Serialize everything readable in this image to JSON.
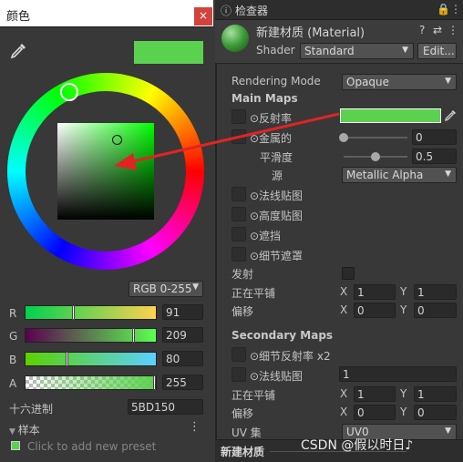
{
  "color_picker": {
    "title": "颜色",
    "close": "×",
    "current_color": "#5bd150",
    "mode": "RGB 0-255",
    "channels": [
      {
        "label": "R",
        "value": "91"
      },
      {
        "label": "G",
        "value": "209"
      },
      {
        "label": "B",
        "value": "80"
      },
      {
        "label": "A",
        "value": "255"
      }
    ],
    "channel_fractions": {
      "R": 0.357,
      "G": 0.82,
      "B": 0.314,
      "A": 1.0
    },
    "hex_label": "十六进制",
    "hex_value": "5BD150",
    "presets_label": "样本",
    "presets_hint": "Click to add new preset",
    "more_icon": "⋮"
  },
  "inspector": {
    "tab_title": "检查器",
    "material_name": "新建材质 (Material)",
    "shader_label": "Shader",
    "shader_value": "Standard",
    "edit_label": "Edit...",
    "rendering_mode_label": "Rendering Mode",
    "rendering_mode_value": "Opaque",
    "main_maps_label": "Main Maps",
    "albedo_label": "⊙反射率",
    "albedo_color": "#5bd150",
    "metallic_label": "⊙金属的",
    "metallic_value": "0",
    "smoothness_label": "平滑度",
    "smoothness_value": "0.5",
    "smoothness_fraction": 0.5,
    "source_label": "源",
    "source_value": "Metallic Alpha",
    "normal_label": "⊙法线贴图",
    "height_label": "⊙高度贴图",
    "occlusion_label": "⊙遮挡",
    "detail_mask_label": "⊙细节遮罩",
    "emission_label": "发射",
    "tiling_label": "正在平铺",
    "offset_label": "偏移",
    "x_label": "X",
    "y_label": "Y",
    "main_tiling_x": "1",
    "main_tiling_y": "1",
    "main_offset_x": "0",
    "main_offset_y": "0",
    "secondary_maps_label": "Secondary Maps",
    "detail_albedo_label": "⊙细节反射率 x2",
    "detail_normal_label": "⊙法线贴图",
    "detail_normal_value": "1",
    "sec_tiling_x": "1",
    "sec_tiling_y": "1",
    "sec_offset_x": "0",
    "sec_offset_y": "0",
    "uv_set_label": "UV 集",
    "uv_set_value": "UV0",
    "footer_title": "新建材质"
  },
  "watermark": "CSDN @假以时日♪",
  "annotation_arrow_color": "#e02424"
}
